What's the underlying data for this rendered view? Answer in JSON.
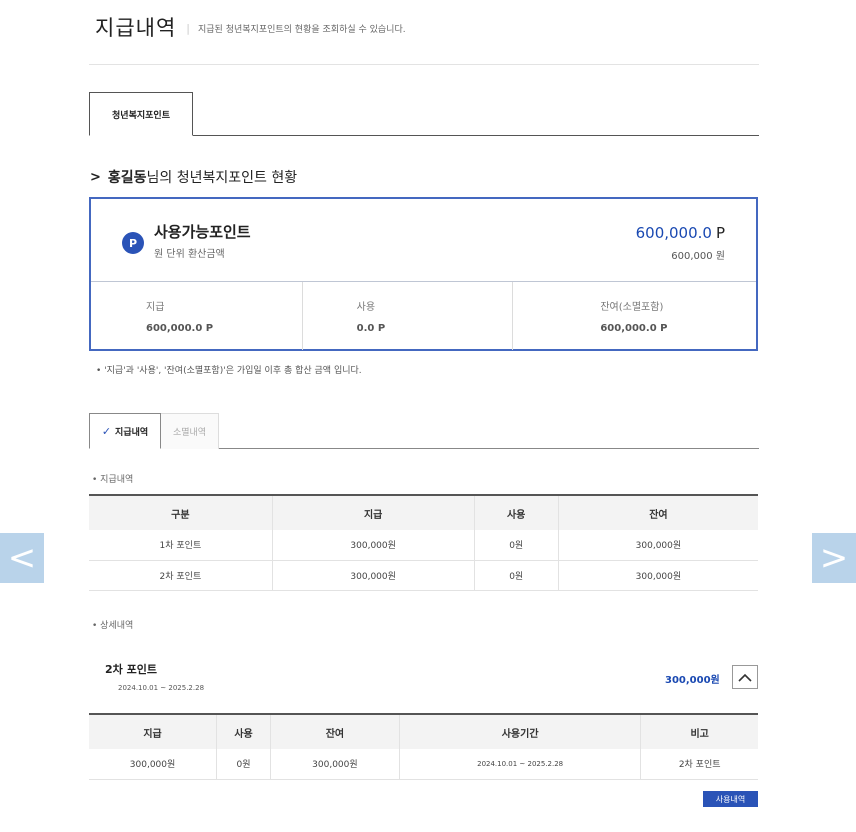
{
  "header": {
    "title": "지급내역",
    "separator": "|",
    "description": "지급된 청년복지포인트의 현황을 조회하실 수 있습니다."
  },
  "nav": {
    "prev_icon": "<",
    "next_icon": ">"
  },
  "main_tab": {
    "label": "청년복지포인트"
  },
  "status": {
    "chevron": ">",
    "user_name": "홍길동",
    "suffix": "님의 청년복지포인트 현황"
  },
  "point_box": {
    "badge": "P",
    "label": "사용가능포인트",
    "sublabel": "원 단위 환산금액",
    "amount": "600,000.0",
    "amount_unit": "P",
    "won": "600,000 원",
    "cells": [
      {
        "label": "지급",
        "value": "600,000.0  P"
      },
      {
        "label": "사용",
        "value": "0.0  P"
      },
      {
        "label": "잔여(소멸포함)",
        "value": "600,000.0  P"
      }
    ]
  },
  "note": "• '지급'과 '사용', '잔여(소멸포함)'은 가입일 이후 총 합산 금액 입니다.",
  "sub_tabs": {
    "active": "지급내역",
    "inactive": "소멸내역",
    "check": "✓"
  },
  "summary": {
    "label": "• 지급내역",
    "headers": [
      "구분",
      "지급",
      "사용",
      "잔여"
    ],
    "rows": [
      [
        "1차 포인트",
        "300,000원",
        "0원",
        "300,000원"
      ],
      [
        "2차 포인트",
        "300,000원",
        "0원",
        "300,000원"
      ]
    ]
  },
  "detail": {
    "label": "• 상세내역",
    "title": "2차 포인트",
    "period": "2024.10.01 ~ 2025.2.28",
    "amount": "300,000원",
    "headers": [
      "지급",
      "사용",
      "잔여",
      "사용기간",
      "비고"
    ],
    "row": [
      "300,000원",
      "0원",
      "300,000원",
      "2024.10.01 ~ 2025.2.28",
      "2차 포인트"
    ],
    "usage_button": "사용내역"
  }
}
